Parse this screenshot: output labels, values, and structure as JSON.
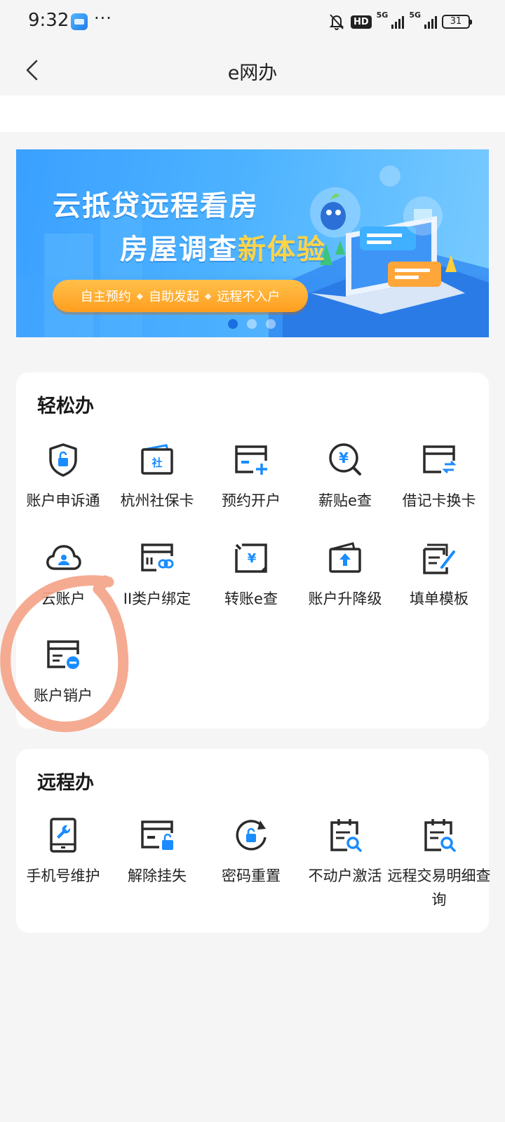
{
  "status_bar": {
    "time": "9:32",
    "more": "···",
    "hd": "HD",
    "net1": "5G",
    "net2": "5G",
    "battery": "31"
  },
  "nav": {
    "title": "e网办",
    "back_icon": "chevron-left-icon"
  },
  "banner": {
    "title_line1": "云抵贷远程看房",
    "title_line2_plain": "房屋调查",
    "title_line2_highlight": "新体验",
    "pill_items": [
      "自主预约",
      "自助发起",
      "远程不入户"
    ],
    "pill_separator": "◆",
    "dots": 3,
    "active_dot": 0
  },
  "sections": [
    {
      "title": "轻松办",
      "items": [
        {
          "label": "账户申诉通",
          "icon": "shield-lock-icon"
        },
        {
          "label": "杭州社保卡",
          "icon": "social-card-icon"
        },
        {
          "label": "预约开户",
          "icon": "card-add-icon"
        },
        {
          "label": "薪贴e查",
          "icon": "yen-search-icon"
        },
        {
          "label": "借记卡换卡",
          "icon": "card-swap-icon"
        },
        {
          "label": "云账户",
          "icon": "cloud-user-icon"
        },
        {
          "label": "II类户绑定",
          "icon": "card-link-icon"
        },
        {
          "label": "转账e查",
          "icon": "yen-transfer-icon"
        },
        {
          "label": "账户升降级",
          "icon": "wallet-upgrade-icon"
        },
        {
          "label": "填单模板",
          "icon": "form-edit-icon"
        },
        {
          "label": "账户销户",
          "icon": "card-cancel-icon"
        }
      ]
    },
    {
      "title": "远程办",
      "items": [
        {
          "label": "手机号维护",
          "icon": "phone-wrench-icon"
        },
        {
          "label": "解除挂失",
          "icon": "card-unlock-icon"
        },
        {
          "label": "密码重置",
          "icon": "lock-refresh-icon"
        },
        {
          "label": "不动户激活",
          "icon": "clipboard-search-icon"
        },
        {
          "label": "远程交易明细查询",
          "icon": "clipboard-detail-search-icon"
        }
      ]
    }
  ],
  "colors": {
    "accent": "#1a8cff",
    "icon_dark": "#2b2b2b",
    "annotation": "#f4a488",
    "page_bg": "#f5f5f6"
  }
}
